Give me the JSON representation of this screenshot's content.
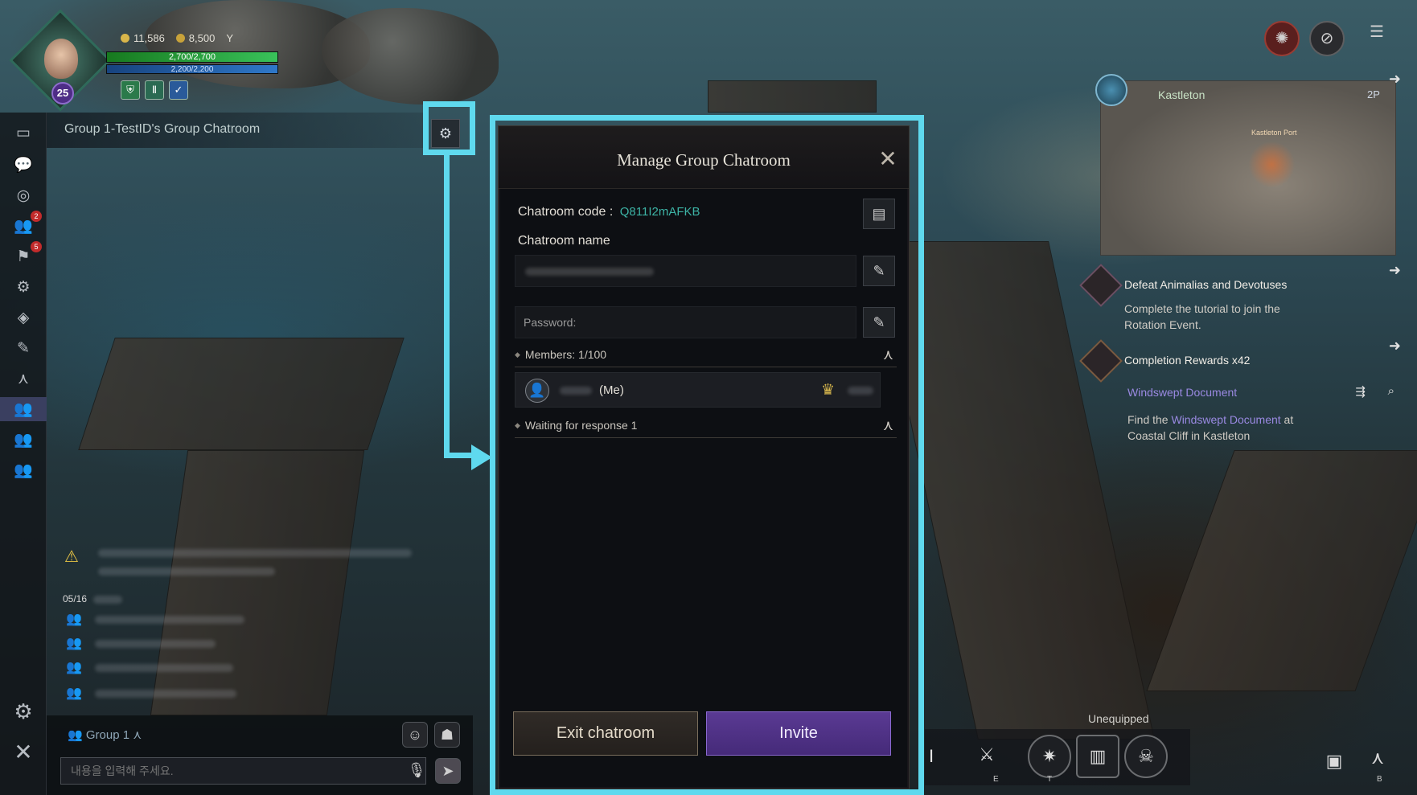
{
  "player": {
    "level": "25",
    "currency_1": "11,586",
    "currency_2": "8,500",
    "currency_unit": "Y",
    "hp": "2,700/2,700",
    "mp": "2,200/2,200"
  },
  "chat": {
    "header_title": "Group 1-TestID's Group Chatroom",
    "date": "05/16",
    "group_label": "Group 1",
    "input_placeholder": "내용을 입력해 주세요."
  },
  "dialog": {
    "title": "Manage Group Chatroom",
    "code_label": "Chatroom code :",
    "code_value": "Q811I2mAFKB",
    "name_label": "Chatroom name",
    "password_placeholder": "Password:",
    "members_label": "Members: 1/100",
    "member_me": "(Me)",
    "waiting_label": "Waiting for response 1",
    "exit_label": "Exit chatroom",
    "invite_label": "Invite"
  },
  "minimap": {
    "region": "Kastleton",
    "floor": "2P",
    "place": "Kastleton Port"
  },
  "quests": [
    {
      "title": "Defeat Animalias and Devotuses",
      "desc": "Complete the tutorial to join the Rotation Event."
    },
    {
      "title": "Completion Rewards x42"
    },
    {
      "title": "Windswept Document",
      "desc_prefix": "Find the ",
      "desc_link": "Windswept Document",
      "desc_suffix": " at Coastal Cliff in Kastleton"
    }
  ],
  "action_bar": {
    "status": "Unequipped",
    "keys": [
      "I",
      "E",
      "T",
      "B"
    ]
  },
  "colors": {
    "highlight": "#5fd9ee",
    "invite": "#5a3a93",
    "code": "#3db4a6"
  }
}
